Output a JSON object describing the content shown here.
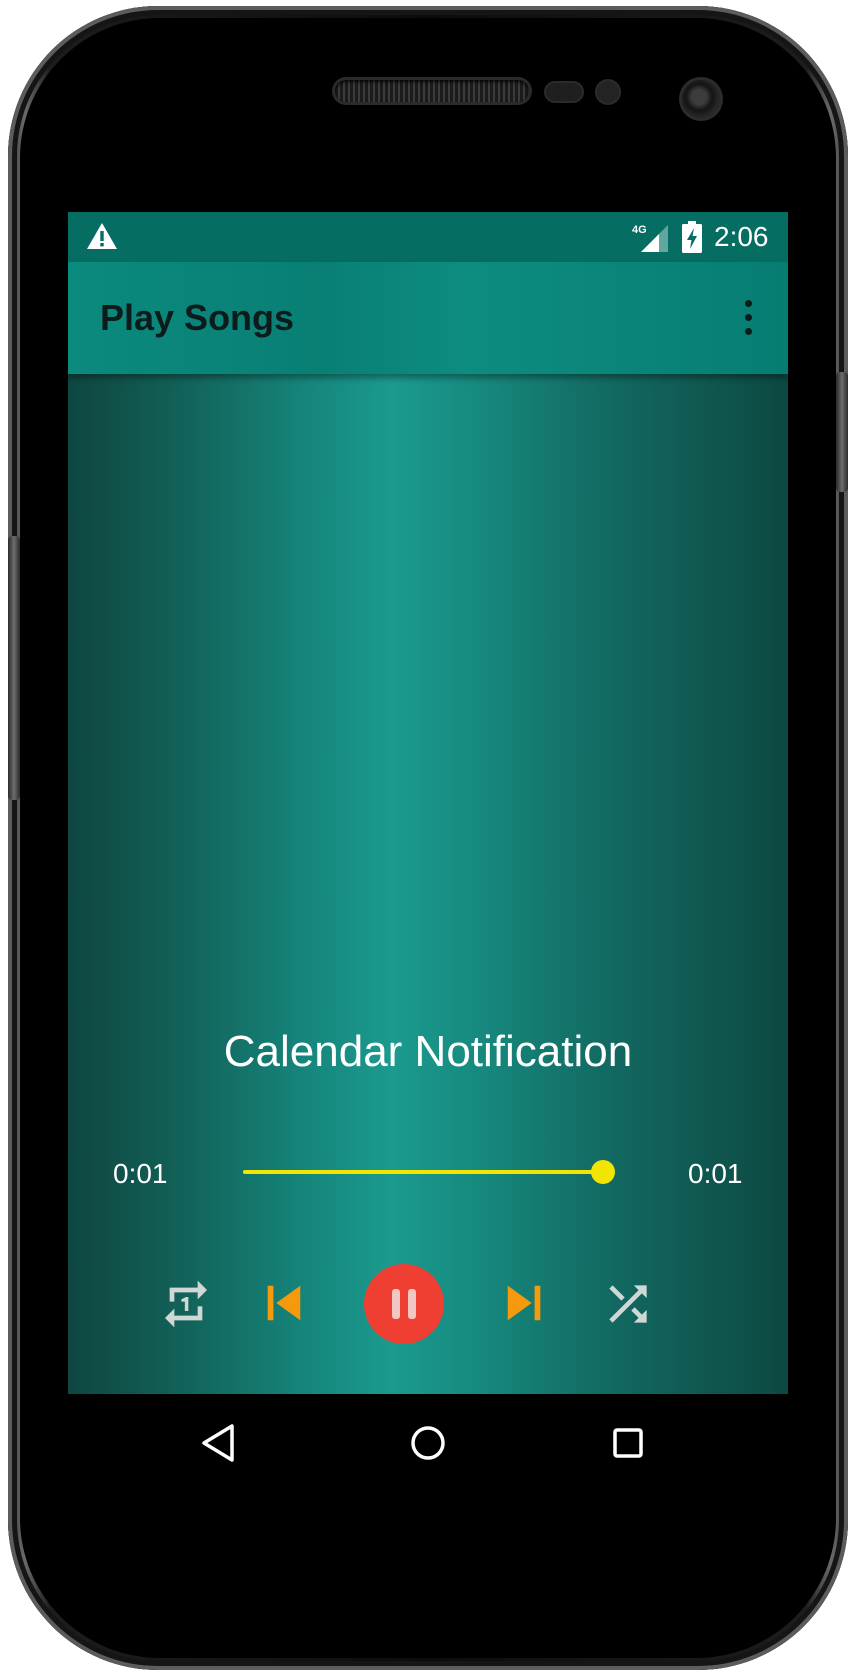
{
  "status_bar": {
    "network": "4G",
    "time": "2:06",
    "icons": [
      "warning-icon",
      "signal-icon",
      "battery-charging-icon"
    ]
  },
  "app_bar": {
    "title": "Play Songs",
    "menu_icon": "more-vert-icon"
  },
  "player": {
    "song_title": "Calendar Notification",
    "elapsed": "0:01",
    "duration": "0:01",
    "progress_fraction": 1.0,
    "controls": [
      "repeat-one-icon",
      "skip-previous-icon",
      "pause-icon",
      "skip-next-icon",
      "shuffle-icon"
    ]
  },
  "nav_bar": {
    "icons": [
      "back-icon",
      "home-icon",
      "recents-icon"
    ]
  },
  "colors": {
    "status_bar": "#066d63",
    "app_bar": "#0a8478",
    "seek_accent": "#f2e600",
    "skip_buttons": "#f59a0c",
    "play_button": "#ef3e32",
    "secondary_controls": "#cfd8d6"
  }
}
